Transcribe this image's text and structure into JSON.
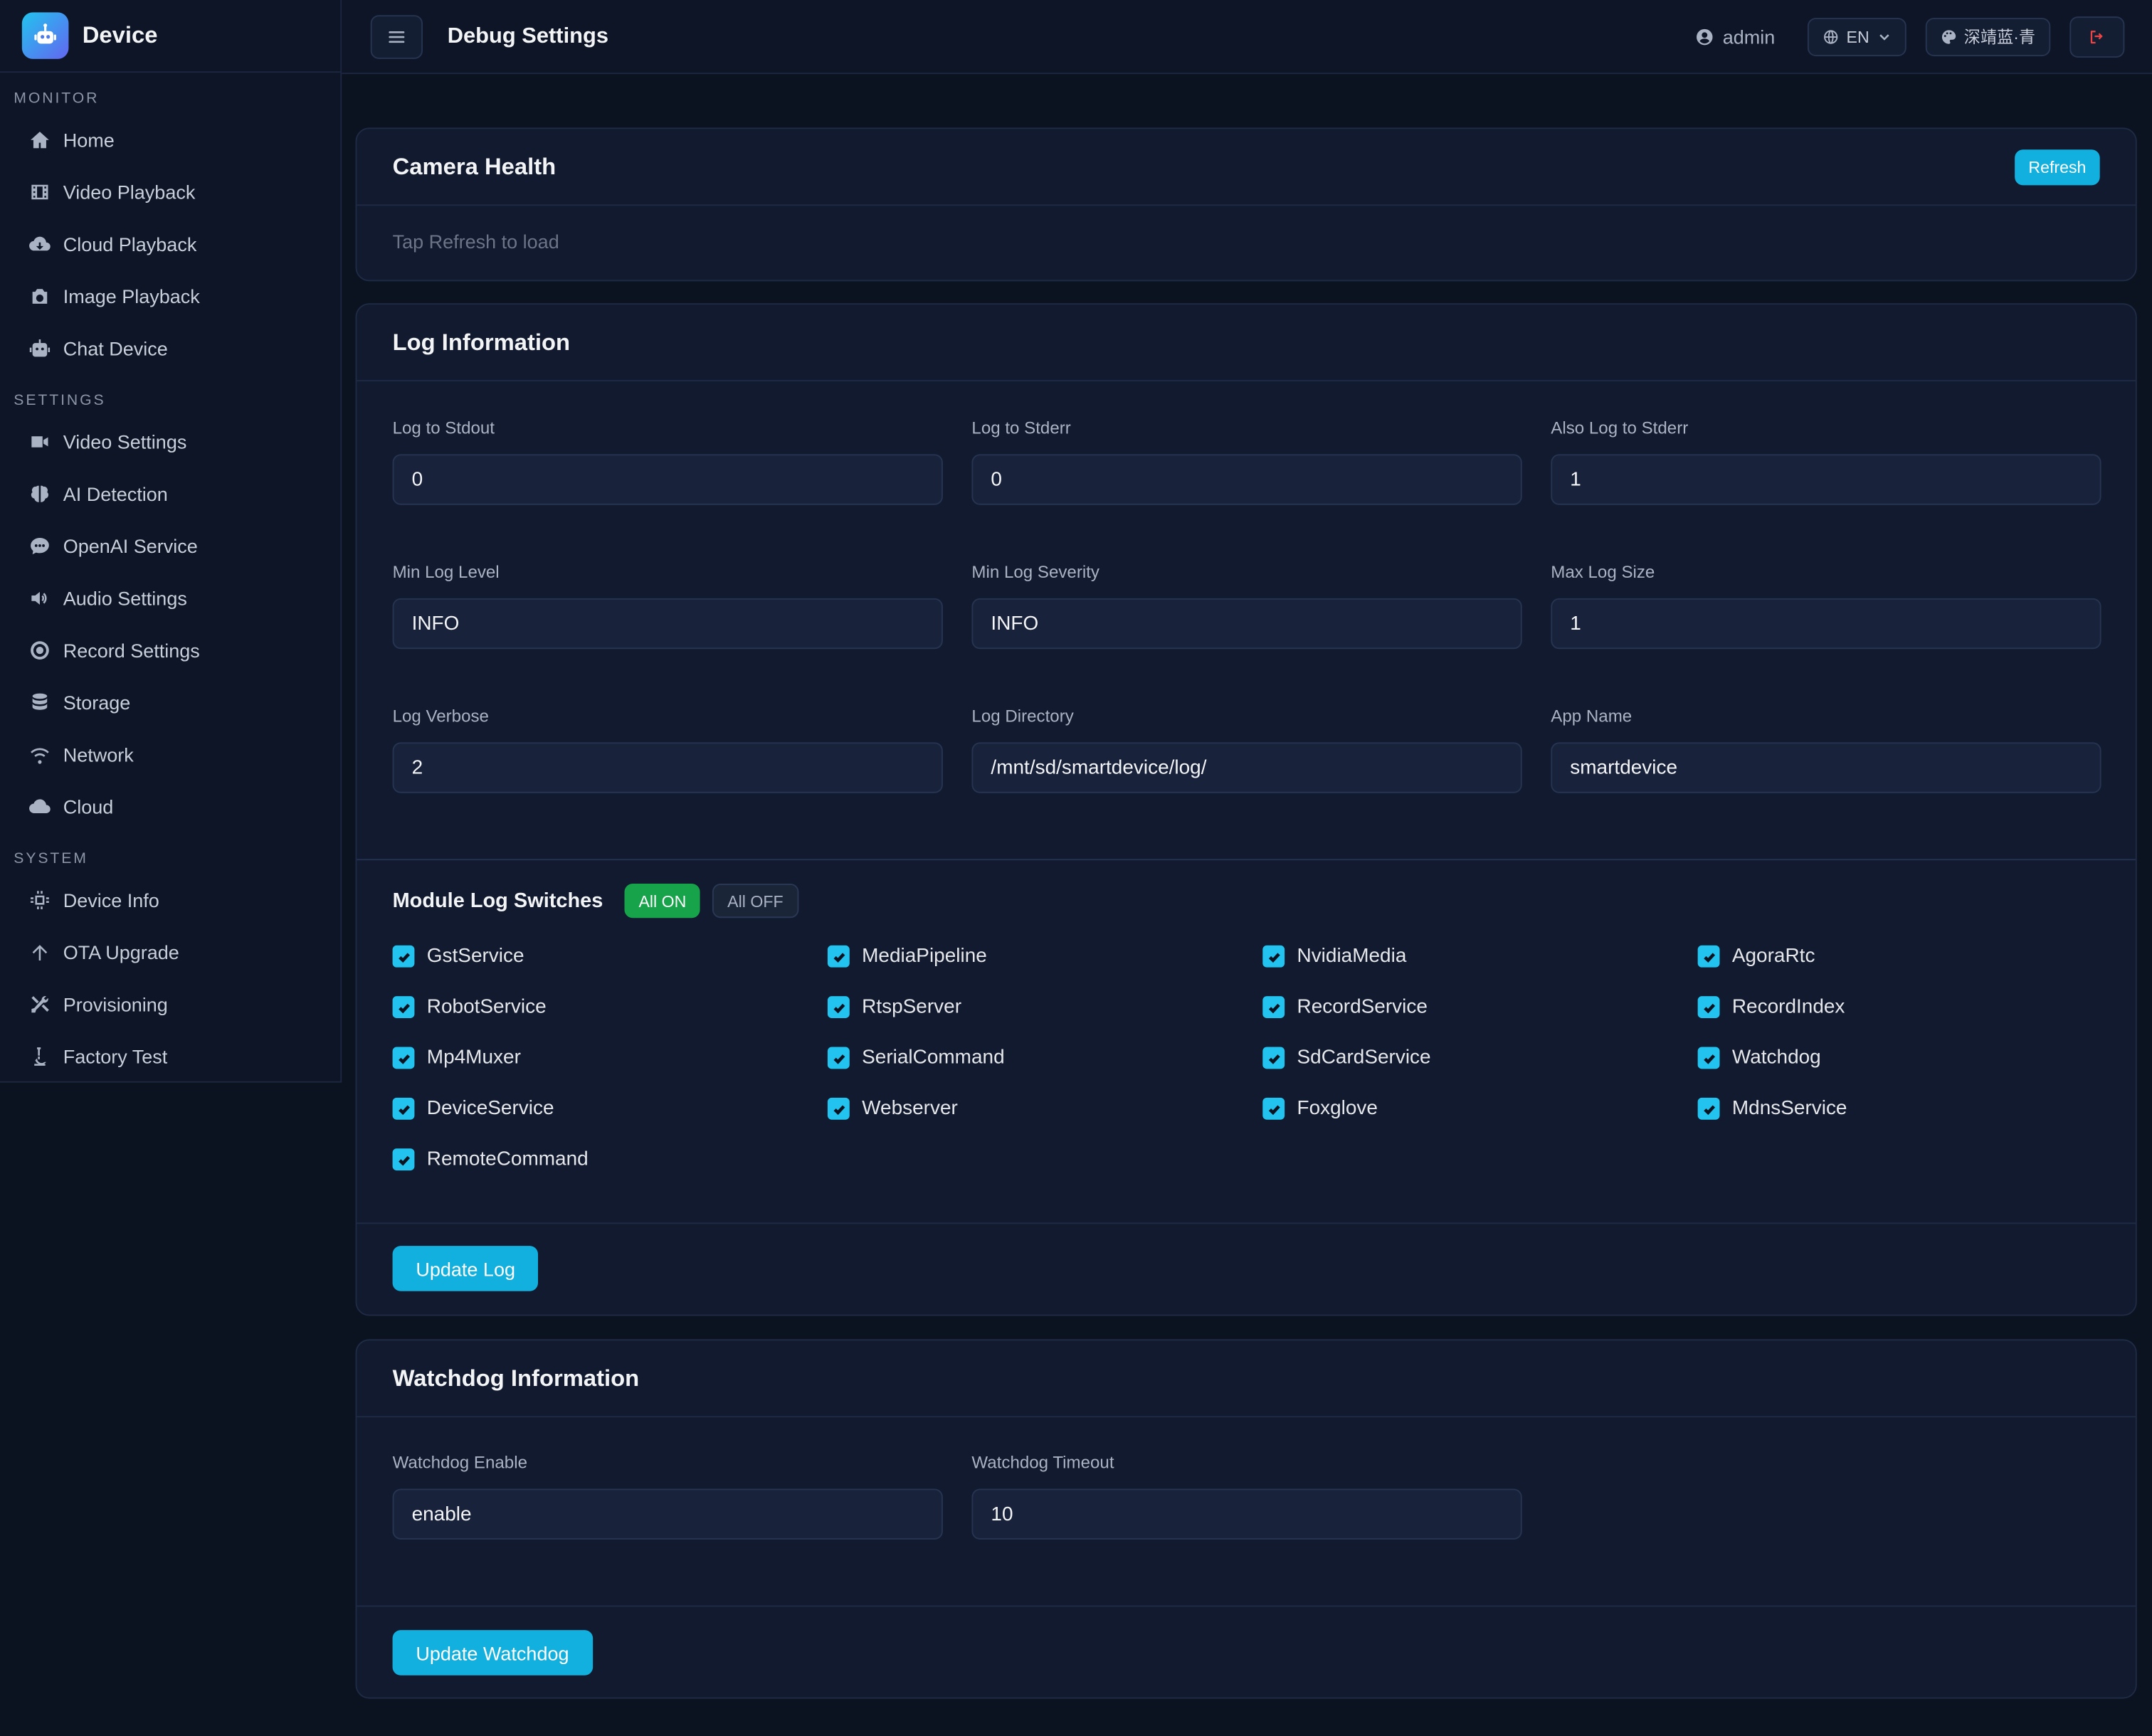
{
  "app": {
    "brand": "Device",
    "page_title": "Debug Settings"
  },
  "header": {
    "user": "admin",
    "language": "EN",
    "theme": "深靖蓝·青"
  },
  "sidebar": {
    "sections": [
      {
        "label": "MONITOR",
        "items": [
          {
            "label": "Home",
            "icon": "home-icon"
          },
          {
            "label": "Video Playback",
            "icon": "film-icon"
          },
          {
            "label": "Cloud Playback",
            "icon": "cloud-download-icon"
          },
          {
            "label": "Image Playback",
            "icon": "camera-icon"
          },
          {
            "label": "Chat Device",
            "icon": "robot-icon"
          }
        ]
      },
      {
        "label": "SETTINGS",
        "items": [
          {
            "label": "Video Settings",
            "icon": "video-icon"
          },
          {
            "label": "AI Detection",
            "icon": "brain-icon"
          },
          {
            "label": "OpenAI Service",
            "icon": "chat-icon"
          },
          {
            "label": "Audio Settings",
            "icon": "speaker-icon"
          },
          {
            "label": "Record Settings",
            "icon": "record-icon"
          },
          {
            "label": "Storage",
            "icon": "database-icon"
          },
          {
            "label": "Network",
            "icon": "wifi-icon"
          },
          {
            "label": "Cloud",
            "icon": "cloud-icon"
          }
        ]
      },
      {
        "label": "SYSTEM",
        "items": [
          {
            "label": "Device Info",
            "icon": "chip-icon"
          },
          {
            "label": "OTA Upgrade",
            "icon": "arrow-up-icon"
          },
          {
            "label": "Provisioning",
            "icon": "tools-icon"
          },
          {
            "label": "Factory Test",
            "icon": "microscope-icon"
          }
        ]
      }
    ]
  },
  "camera_health": {
    "title": "Camera Health",
    "refresh_label": "Refresh",
    "placeholder": "Tap Refresh to load"
  },
  "log_info": {
    "title": "Log Information",
    "fields": [
      {
        "label": "Log to Stdout",
        "value": "0"
      },
      {
        "label": "Log to Stderr",
        "value": "0"
      },
      {
        "label": "Also Log to Stderr",
        "value": "1"
      },
      {
        "label": "Min Log Level",
        "value": "INFO"
      },
      {
        "label": "Min Log Severity",
        "value": "INFO"
      },
      {
        "label": "Max Log Size",
        "value": "1"
      },
      {
        "label": "Log Verbose",
        "value": "2"
      },
      {
        "label": "Log Directory",
        "value": "/mnt/sd/smartdevice/log/"
      },
      {
        "label": "App Name",
        "value": "smartdevice"
      }
    ],
    "modules_title": "Module Log Switches",
    "all_on_label": "All ON",
    "all_off_label": "All OFF",
    "modules": [
      {
        "label": "GstService",
        "checked": true
      },
      {
        "label": "MediaPipeline",
        "checked": true
      },
      {
        "label": "NvidiaMedia",
        "checked": true
      },
      {
        "label": "AgoraRtc",
        "checked": true
      },
      {
        "label": "RobotService",
        "checked": true
      },
      {
        "label": "RtspServer",
        "checked": true
      },
      {
        "label": "RecordService",
        "checked": true
      },
      {
        "label": "RecordIndex",
        "checked": true
      },
      {
        "label": "Mp4Muxer",
        "checked": true
      },
      {
        "label": "SerialCommand",
        "checked": true
      },
      {
        "label": "SdCardService",
        "checked": true
      },
      {
        "label": "Watchdog",
        "checked": true
      },
      {
        "label": "DeviceService",
        "checked": true
      },
      {
        "label": "Webserver",
        "checked": true
      },
      {
        "label": "Foxglove",
        "checked": true
      },
      {
        "label": "MdnsService",
        "checked": true
      },
      {
        "label": "RemoteCommand",
        "checked": true
      }
    ],
    "update_label": "Update Log"
  },
  "watchdog": {
    "title": "Watchdog Information",
    "fields": [
      {
        "label": "Watchdog Enable",
        "value": "enable"
      },
      {
        "label": "Watchdog Timeout",
        "value": "10"
      }
    ],
    "update_label": "Update Watchdog"
  },
  "colors": {
    "accent": "#12b0de",
    "success": "#16a34a",
    "background": "#0b1220",
    "card": "#111a2e",
    "danger": "#ef4444"
  }
}
